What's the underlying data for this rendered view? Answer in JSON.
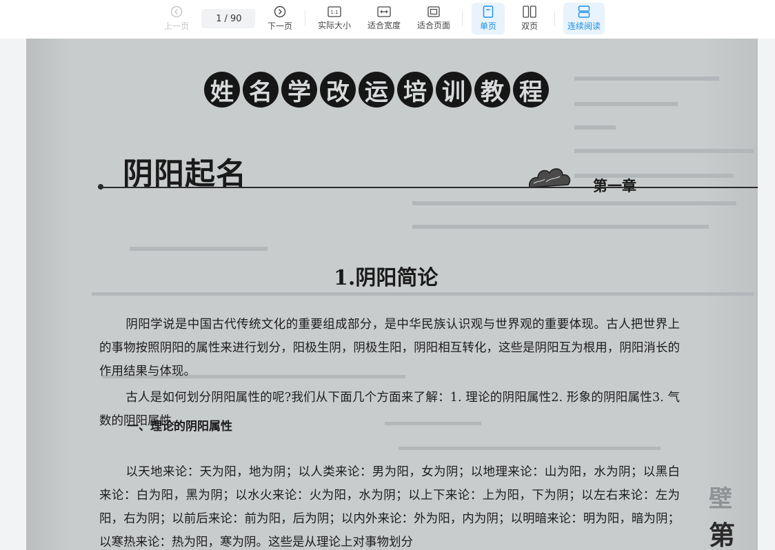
{
  "toolbar": {
    "prev_label": "上一页",
    "page_current": "1",
    "page_total": "/ 90",
    "next_label": "下一页",
    "actual_size_label": "实际大小",
    "fit_width_label": "适合宽度",
    "fit_page_label": "适合页面",
    "single_label": "单页",
    "double_label": "双页",
    "continuous_label": "连续阅读",
    "actual_size_glyph": "1:1"
  },
  "document": {
    "banner_chars": [
      "姓",
      "名",
      "学",
      "改",
      "运",
      "培",
      "训",
      "教",
      "程"
    ],
    "chapter_title": "阴阳起名",
    "chapter_number": "第一章",
    "section_heading": "1.阴阳简论",
    "paragraph_1": "阴阳学说是中国古代传统文化的重要组成部分，是中华民族认识观与世界观的重要体现。古人把世界上的事物按照阴阳的属性来进行划分，阳极生阴，阴极生阳，阴阳相互转化，这些是阴阳互为根用，阴阳消长的作用结果与体现。",
    "paragraph_2": "古人是如何划分阴阳属性的呢?我们从下面几个方面来了解：1. 理论的阴阳属性2. 形象的阴阳属性3. 气数的阴阳属性。",
    "subheading_1": "一、理论的阴阳属性",
    "paragraph_3": "以天地来论：天为阳，地为阴；以人类来论：男为阳，女为阴；以地理来论：山为阳，水为阴；以黑白来论：白为阳，黑为阴；以水火来论：火为阳，水为阴；以上下来论：上为阳，下为阴；以左右来论：左为阳，右为阴；以前后来论：前为阳，后为阴；以内外来论：外为阳，内为阴；以明暗来论：明为阳，暗为阴；以寒热来论：热为阳，寒为阴。这些是从理论上对事物划分",
    "side_glyph_1": "壁",
    "side_glyph_2": "第"
  },
  "colors": {
    "accent": "#1a8fe3",
    "active_bg": "#e8f3fc",
    "page_bg": "#c9cccd"
  }
}
